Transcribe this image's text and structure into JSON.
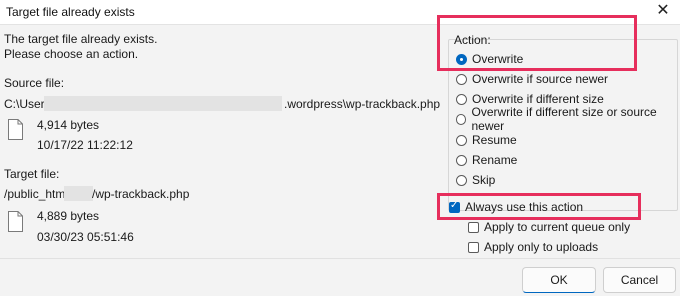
{
  "window": {
    "title": "Target file already exists",
    "close_glyph": "✕"
  },
  "message": {
    "line1": "The target file already exists.",
    "line2": "Please choose an action."
  },
  "source": {
    "label": "Source file:",
    "path_prefix": "C:\\Users",
    "path_suffix": ".wordpress\\wp-trackback.php",
    "size": "4,914 bytes",
    "date": "10/17/22 11:22:12"
  },
  "target": {
    "label": "Target file:",
    "path_prefix": "/public_html/",
    "path_suffix": "/wp-trackback.php",
    "size": "4,889 bytes",
    "date": "03/30/23 05:51:46"
  },
  "action": {
    "label": "Action:",
    "options": [
      {
        "label": "Overwrite",
        "selected": true
      },
      {
        "label": "Overwrite if source newer",
        "selected": false
      },
      {
        "label": "Overwrite if different size",
        "selected": false
      },
      {
        "label": "Overwrite if different size or source newer",
        "selected": false
      },
      {
        "label": "Resume",
        "selected": false
      },
      {
        "label": "Rename",
        "selected": false
      },
      {
        "label": "Skip",
        "selected": false
      }
    ]
  },
  "checkboxes": {
    "always_use": {
      "label": "Always use this action",
      "checked": true
    },
    "current_queue": {
      "label": "Apply to current queue only",
      "checked": false
    },
    "uploads_only": {
      "label": "Apply only to uploads",
      "checked": false
    }
  },
  "buttons": {
    "ok": "OK",
    "cancel": "Cancel"
  },
  "colors": {
    "accent": "#0067c0",
    "annotation_highlight": "#e62e5c"
  },
  "icons": {
    "file": "file-icon",
    "close": "close-icon"
  }
}
